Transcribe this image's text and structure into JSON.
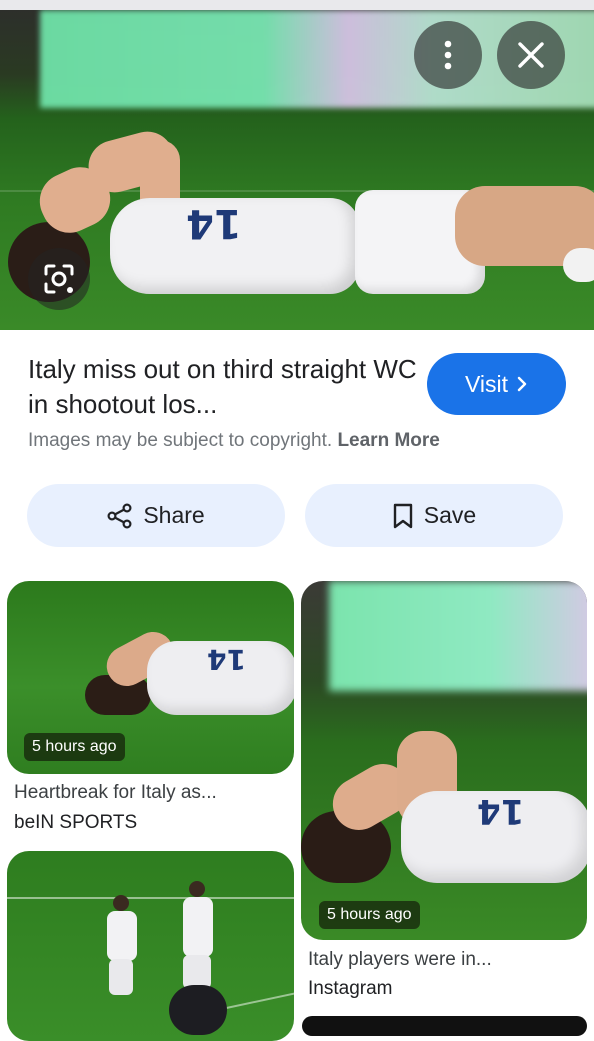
{
  "hero": {
    "jersey_number": "14",
    "buttons": {
      "more": "more-vert-icon",
      "close": "close-icon",
      "lens": "lens-icon"
    }
  },
  "result": {
    "title": "Italy miss out on third straight WC in shootout los...",
    "visit_label": "Visit",
    "copyright_text": "Images may be subject to copyright.",
    "learn_more": "Learn More"
  },
  "actions": {
    "share": "Share",
    "save": "Save"
  },
  "related": [
    {
      "time": "5 hours ago",
      "title": "Heartbreak for Italy as...",
      "source": "beIN SPORTS"
    },
    {
      "time": "5 hours ago",
      "title": "Italy players were in...",
      "source": "Instagram"
    },
    {
      "time": "",
      "title": "",
      "source": ""
    }
  ],
  "colors": {
    "accent": "#1a73e8",
    "pill_bg": "#e8f0fe",
    "grass": "#2f7b22"
  }
}
